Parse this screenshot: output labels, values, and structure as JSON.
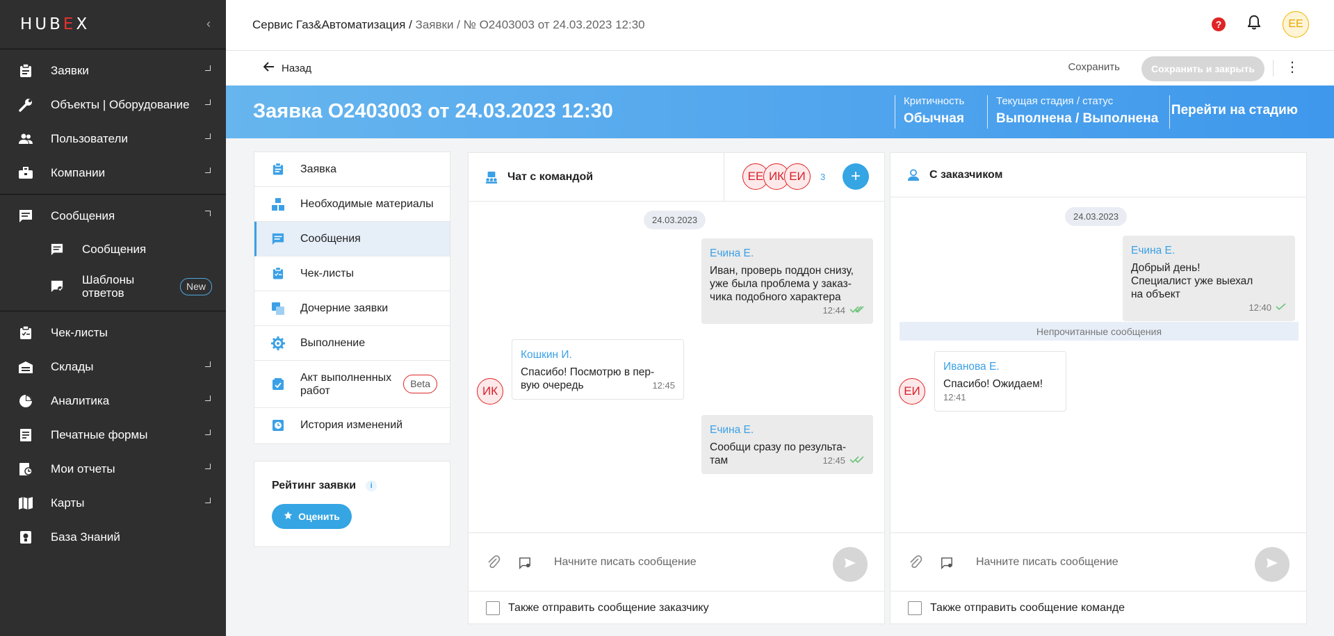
{
  "app": {
    "logo_prefix": "HUB",
    "logo_e": "E",
    "logo_suffix": "X",
    "collapse_icon": "chevron-left-icon"
  },
  "sidebar": {
    "items": [
      {
        "label": "Заявки",
        "icon": "clipboard-icon"
      },
      {
        "label": "Объекты | Оборудование",
        "icon": "wrench-icon"
      },
      {
        "label": "Пользователи",
        "icon": "users-icon"
      },
      {
        "label": "Компании",
        "icon": "briefcase-icon"
      },
      {
        "label": "Сообщения",
        "icon": "message-icon"
      },
      {
        "label": "Чек-листы",
        "icon": "checklist-icon"
      },
      {
        "label": "Склады",
        "icon": "warehouse-icon"
      },
      {
        "label": "Аналитика",
        "icon": "pie-chart-icon"
      },
      {
        "label": "Печатные формы",
        "icon": "print-form-icon"
      },
      {
        "label": "Мои отчеты",
        "icon": "reports-icon"
      },
      {
        "label": "Карты",
        "icon": "map-icon"
      },
      {
        "label": "База Знаний",
        "icon": "knowledge-icon"
      }
    ],
    "sub_items": [
      {
        "label": "Сообщения",
        "icon": "message-icon"
      },
      {
        "label": "Шаблоны ответов",
        "badge": "New",
        "icon": "template-icon"
      }
    ]
  },
  "header": {
    "breadcrumb_root": "Сервис Газ&Автоматизация /",
    "breadcrumb_rest": " Заявки / № О2403003 от 24.03.2023 12:30",
    "avatar": "ЕЕ",
    "help": "?"
  },
  "actions": {
    "back": "Назад",
    "save": "Сохранить",
    "save_close": "Сохранить и закрыть",
    "kebab": "⋮"
  },
  "banner": {
    "title": "Заявка О2403003 от 24.03.2023 12:30",
    "criticality_label": "Критичность",
    "criticality_value": "Обычная",
    "stage_label": "Текущая стадия / статус",
    "stage_value": "Выполнена / Выполнена",
    "goto_stage": "Перейти на стадию"
  },
  "menu": {
    "items": [
      {
        "label": "Заявка",
        "icon": "clipboard-icon"
      },
      {
        "label": "Необходимые материалы",
        "icon": "materials-icon"
      },
      {
        "label": "Сообщения",
        "icon": "message-icon"
      },
      {
        "label": "Чек-листы",
        "icon": "checklist-icon"
      },
      {
        "label": "Дочерние заявки",
        "icon": "child-requests-icon"
      },
      {
        "label": "Выполнение",
        "icon": "gear-icon"
      },
      {
        "label": "Акт выполненных работ",
        "badge": "Beta",
        "icon": "act-icon"
      },
      {
        "label": "История изменений",
        "icon": "history-icon"
      }
    ],
    "active": "Сообщения"
  },
  "rating": {
    "title": "Рейтинг заявки",
    "info": "i",
    "button": "Оценить"
  },
  "team_chat": {
    "title": "Чат с командой",
    "members": [
      "ЕЕ",
      "ИК",
      "ЕИ"
    ],
    "member_count": "3",
    "add": "+",
    "date": "24.03.2023",
    "messages": [
      {
        "author": "Ечина Е.",
        "text": "Иван, проверь поддон снизу, уже была проблема у заказ- чика подобного характера",
        "time": "12:44"
      },
      {
        "author": "Кошкин И.",
        "avatar": "ИК",
        "text": "Спасибо! Посмотрю в пер- вую очередь",
        "time": "12:45"
      },
      {
        "author": "Ечина Е.",
        "text": "Сообщи сразу по результа- там",
        "time": "12:45"
      }
    ],
    "placeholder": "Начните писать сообщение",
    "checkbox": "Также отправить сообщение заказчику"
  },
  "client_chat": {
    "title": "С заказчиком",
    "date": "24.03.2023",
    "unread": "Непрочитанные сообщения",
    "messages": [
      {
        "author": "Ечина Е.",
        "text": "Добрый день! Специалист уже выехал на объект",
        "time": "12:40"
      },
      {
        "author": "Иванова Е.",
        "avatar": "ЕИ",
        "text": "Спасибо! Ожидаем!",
        "time": "12:41"
      }
    ],
    "placeholder": "Начните писать сообщение",
    "checkbox": "Также отправить сообщение команде"
  }
}
